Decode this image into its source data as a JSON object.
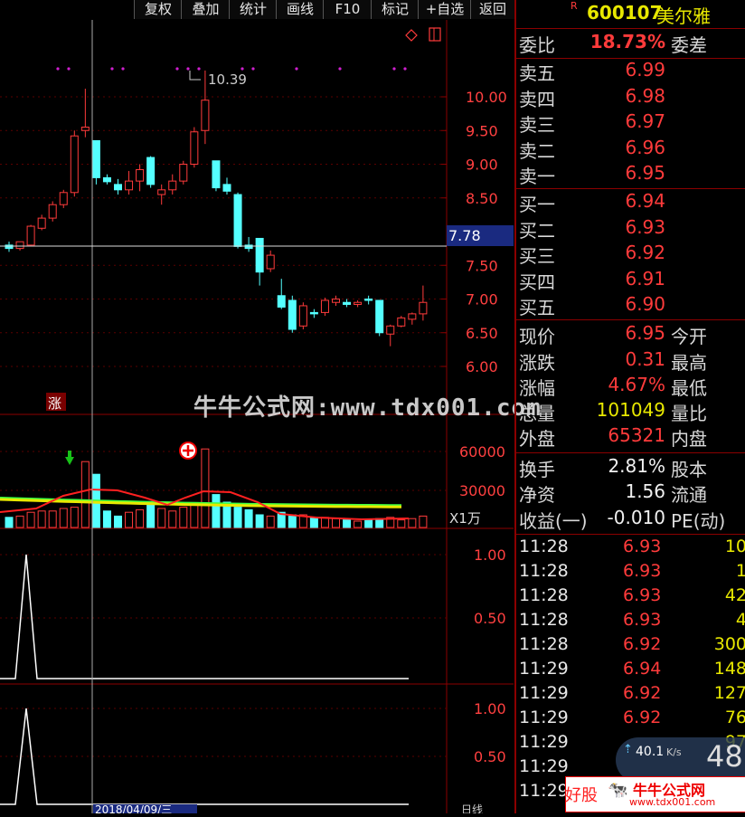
{
  "toolbar": {
    "items": [
      "复权",
      "叠加",
      "统计",
      "画线",
      "F10",
      "标记",
      "+自选",
      "返回"
    ]
  },
  "stock": {
    "badge": "R",
    "code": "600107",
    "name": "美尔雅"
  },
  "commission": {
    "ratio_label": "委比",
    "ratio_value": "18.73%",
    "diff_label": "委差"
  },
  "asks": [
    {
      "label": "卖五",
      "price": "6.99"
    },
    {
      "label": "卖四",
      "price": "6.98"
    },
    {
      "label": "卖三",
      "price": "6.97"
    },
    {
      "label": "卖二",
      "price": "6.96"
    },
    {
      "label": "卖一",
      "price": "6.95"
    }
  ],
  "bids": [
    {
      "label": "买一",
      "price": "6.94"
    },
    {
      "label": "买二",
      "price": "6.93"
    },
    {
      "label": "买三",
      "price": "6.92"
    },
    {
      "label": "买四",
      "price": "6.91"
    },
    {
      "label": "买五",
      "price": "6.90"
    }
  ],
  "quote": {
    "price_label": "现价",
    "price": "6.95",
    "open_label": "今开",
    "change_label": "涨跌",
    "change": "0.31",
    "high_label": "最高",
    "pct_label": "涨幅",
    "pct": "4.67%",
    "low_label": "最低",
    "volume_label": "总量",
    "volume": "101049",
    "vol_ratio_label": "量比",
    "outer_label": "外盘",
    "outer": "65321",
    "inner_label": "内盘"
  },
  "fundamentals": {
    "turnover_label": "换手",
    "turnover": "2.81%",
    "equity_label": "股本",
    "nav_label": "净资",
    "nav": "1.56",
    "float_label": "流通",
    "eps_label": "收益(一)",
    "eps": "-0.010",
    "pe_label": "PE(动)"
  },
  "ticks": [
    {
      "time": "11:28",
      "price": "6.93",
      "vol": "10"
    },
    {
      "time": "11:28",
      "price": "6.93",
      "vol": "1"
    },
    {
      "time": "11:28",
      "price": "6.93",
      "vol": "42"
    },
    {
      "time": "11:28",
      "price": "6.93",
      "vol": "4"
    },
    {
      "time": "11:28",
      "price": "6.92",
      "vol": "300"
    },
    {
      "time": "11:29",
      "price": "6.94",
      "vol": "148"
    },
    {
      "time": "11:29",
      "price": "6.92",
      "vol": "127"
    },
    {
      "time": "11:29",
      "price": "6.92",
      "vol": "76"
    },
    {
      "time": "11:29",
      "price": "",
      "vol": "97"
    },
    {
      "time": "11:29",
      "price": "",
      "vol": ""
    },
    {
      "time": "11:29",
      "price": "",
      "vol": ""
    }
  ],
  "net": {
    "speed": "40.1",
    "unit": "K/s",
    "big": "48"
  },
  "watermark": "牛牛公式网:www.tdx001.com",
  "logo": {
    "text": "牛牛公式网",
    "url": "www.tdx001.com",
    "left_text": "好股"
  },
  "chart": {
    "main_labels": [
      "10.00",
      "9.50",
      "9.00",
      "8.50",
      "7.50",
      "7.00",
      "6.50",
      "6.00"
    ],
    "current_price_tag": "7.78",
    "high_annotation": "10.39",
    "up_marker": "涨",
    "vol_labels": [
      "60000",
      "30000"
    ],
    "vol_unit": "X1万",
    "ind1_labels": [
      "1.00",
      "0.50"
    ],
    "ind2_labels": [
      "1.00",
      "0.50"
    ],
    "date_fragment": "2018/04/09/三",
    "bottom_fragment": "日线"
  },
  "colors": {
    "up": "#ff3b3b",
    "down": "#54ffff",
    "ma_red": "#ff2020",
    "ma_yellow": "#e8e800",
    "ma_green": "#40ff40"
  }
}
